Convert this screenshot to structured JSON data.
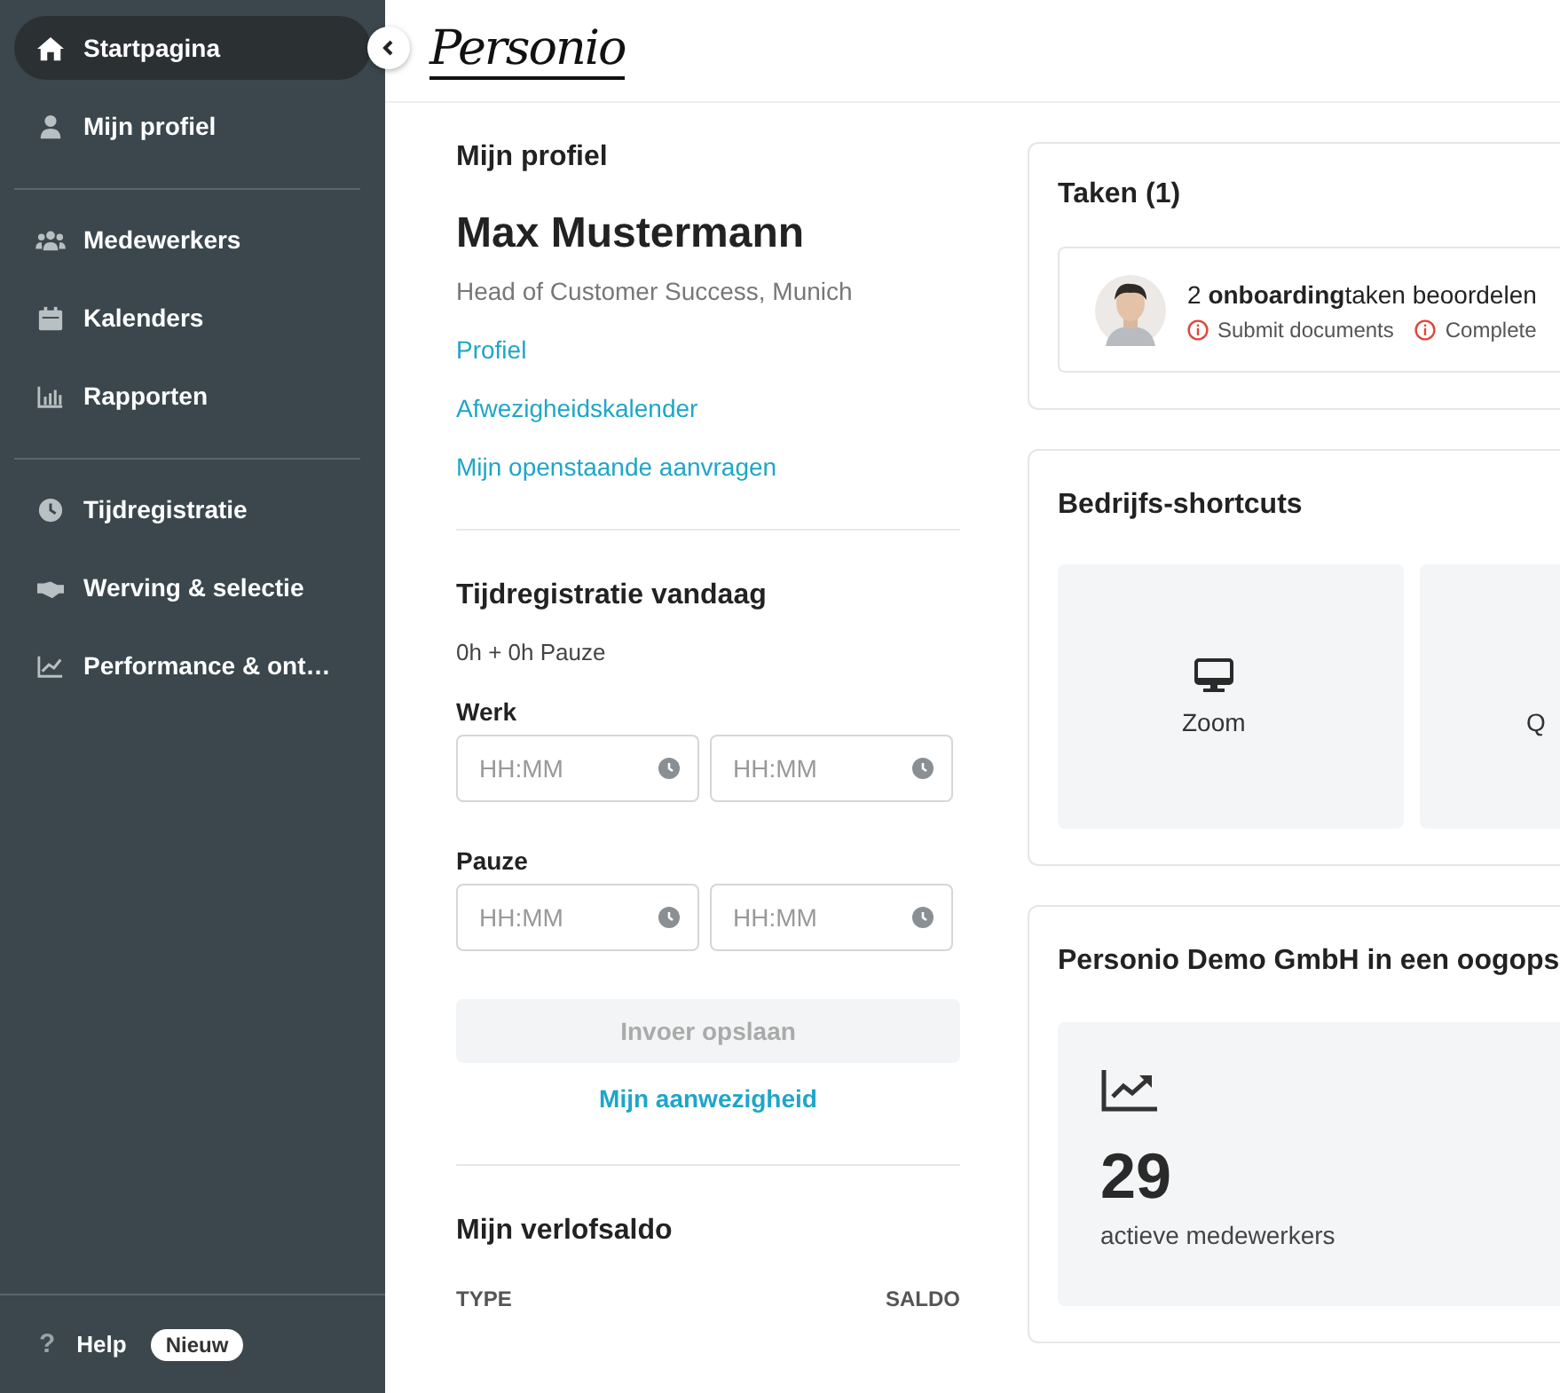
{
  "sidebar": {
    "groups": [
      {
        "items": [
          {
            "label": "Startpagina",
            "selected": true
          },
          {
            "label": "Mijn profiel",
            "selected": false
          }
        ]
      },
      {
        "items": [
          {
            "label": "Medewerkers",
            "selected": false
          },
          {
            "label": "Kalenders",
            "selected": false
          },
          {
            "label": "Rapporten",
            "selected": false
          }
        ]
      },
      {
        "items": [
          {
            "label": "Tijdregistratie",
            "selected": false
          },
          {
            "label": "Werving & selectie",
            "selected": false
          },
          {
            "label": "Performance & ont…",
            "selected": false
          }
        ]
      }
    ],
    "help": {
      "icon": "?",
      "label": "Help",
      "badge": "Nieuw"
    }
  },
  "header": {
    "logo": "Personio"
  },
  "profile": {
    "heading": "Mijn profiel",
    "name": "Max Mustermann",
    "role": "Head of Customer Success, Munich",
    "links": [
      "Profiel",
      "Afwezigheidskalender",
      "Mijn openstaande aanvragen"
    ]
  },
  "time_tracking": {
    "heading": "Tijdregistratie vandaag",
    "summary": "0h + 0h Pauze",
    "rows": [
      {
        "label": "Werk",
        "fields": [
          {
            "placeholder": "HH:MM"
          },
          {
            "placeholder": "HH:MM"
          }
        ]
      },
      {
        "label": "Pauze",
        "fields": [
          {
            "placeholder": "HH:MM"
          },
          {
            "placeholder": "HH:MM"
          }
        ]
      }
    ],
    "save_button": {
      "label": "Invoer opslaan",
      "disabled": true
    },
    "link": "Mijn aanwezigheid"
  },
  "leave": {
    "heading": "Mijn verlofsaldo",
    "columns": [
      "TYPE",
      "SALDO"
    ]
  },
  "tasks": {
    "title": "Taken (1)",
    "items": [
      {
        "text": "2 **onboarding**taken beoordelen",
        "subtasks": [
          "Submit documents",
          "Complete"
        ]
      }
    ]
  },
  "shortcuts": {
    "title": "Bedrijfs-shortcuts",
    "items": [
      {
        "label": "Zoom",
        "icon": true
      },
      {
        "label": "Q",
        "icon": false
      }
    ]
  },
  "overview": {
    "title": "Personio Demo GmbH in een oogops",
    "stats": [
      {
        "value": "29",
        "label": "actieve medewerkers"
      }
    ]
  }
}
